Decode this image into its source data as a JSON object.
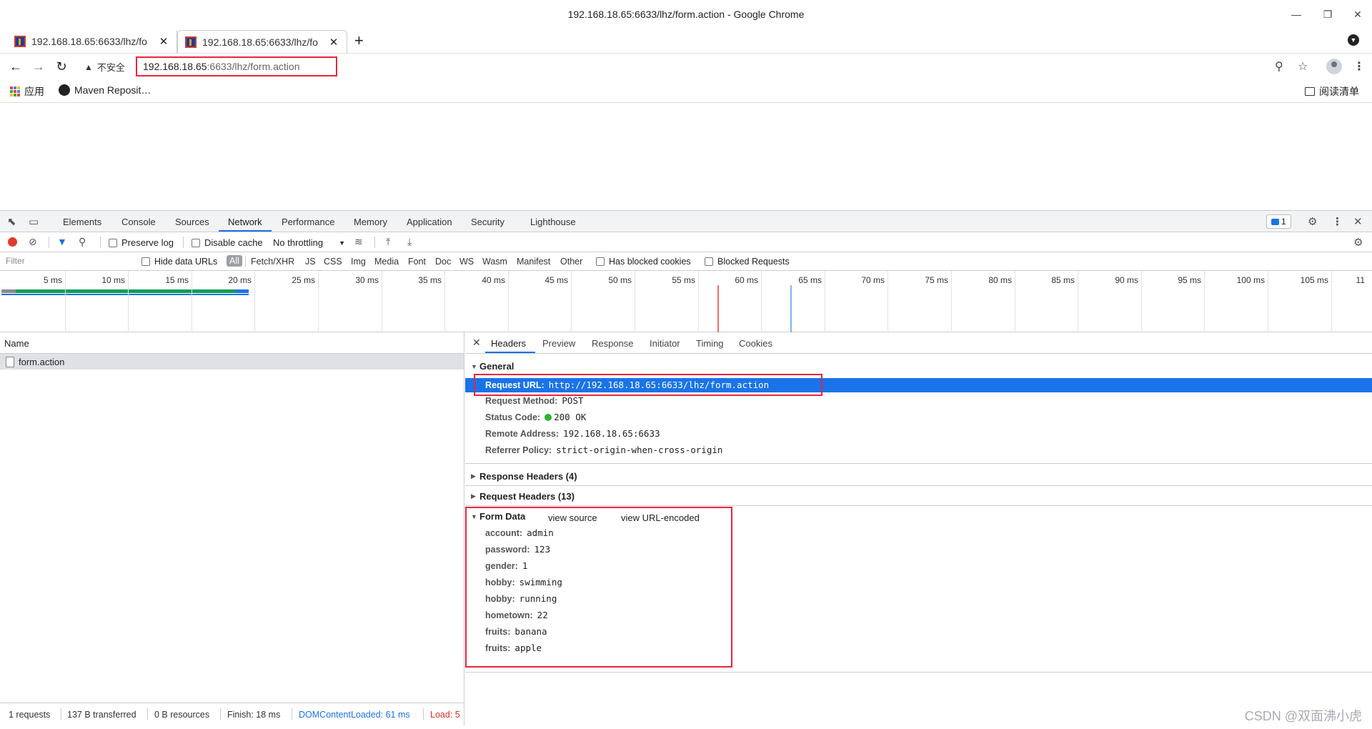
{
  "window": {
    "title": "192.168.18.65:6633/lhz/form.action - Google Chrome"
  },
  "tabs": [
    {
      "label": "192.168.18.65:6633/lhz/fo"
    },
    {
      "label": "192.168.18.65:6633/lhz/fo"
    }
  ],
  "omnibox": {
    "security_label": "不安全",
    "url_host": "192.168.18.65",
    "url_rest": ":6633/lhz/form.action"
  },
  "bookmarks": {
    "apps_label": "应用",
    "items": [
      {
        "label": "Maven Reposit…"
      }
    ],
    "reading_list": "阅读清单"
  },
  "devtools": {
    "tabs": [
      "Elements",
      "Console",
      "Sources",
      "Network",
      "Performance",
      "Memory",
      "Application",
      "Security",
      "Lighthouse"
    ],
    "active_tab": "Network",
    "issues_count": "1",
    "network_toolbar": {
      "preserve_log": "Preserve log",
      "disable_cache": "Disable cache",
      "throttling": "No throttling"
    },
    "filter": {
      "placeholder": "Filter",
      "hide_data_urls": "Hide data URLs",
      "types": [
        "All",
        "Fetch/XHR",
        "JS",
        "CSS",
        "Img",
        "Media",
        "Font",
        "Doc",
        "WS",
        "Wasm",
        "Manifest",
        "Other"
      ],
      "has_blocked_cookies": "Has blocked cookies",
      "blocked_requests": "Blocked Requests"
    },
    "timeline_ticks": [
      "5 ms",
      "10 ms",
      "15 ms",
      "20 ms",
      "25 ms",
      "30 ms",
      "35 ms",
      "40 ms",
      "45 ms",
      "50 ms",
      "55 ms",
      "60 ms",
      "65 ms",
      "70 ms",
      "75 ms",
      "80 ms",
      "85 ms",
      "90 ms",
      "95 ms",
      "100 ms",
      "105 ms",
      "11"
    ],
    "request_list": {
      "header": "Name",
      "rows": [
        {
          "name": "form.action"
        }
      ]
    },
    "detail_tabs": [
      "Headers",
      "Preview",
      "Response",
      "Initiator",
      "Timing",
      "Cookies"
    ],
    "general": {
      "title": "General",
      "rows": [
        {
          "key": "Request URL:",
          "value": "http://192.168.18.65:6633/lhz/form.action"
        },
        {
          "key": "Request Method:",
          "value": "POST"
        },
        {
          "key": "Status Code:",
          "value": "200 OK"
        },
        {
          "key": "Remote Address:",
          "value": "192.168.18.65:6633"
        },
        {
          "key": "Referrer Policy:",
          "value": "strict-origin-when-cross-origin"
        }
      ]
    },
    "response_headers": "Response Headers (4)",
    "request_headers": "Request Headers (13)",
    "form_data": {
      "title": "Form Data",
      "view_source": "view source",
      "view_url_encoded": "view URL-encoded",
      "rows": [
        {
          "key": "account:",
          "value": "admin"
        },
        {
          "key": "password:",
          "value": "123"
        },
        {
          "key": "gender:",
          "value": "1"
        },
        {
          "key": "hobby:",
          "value": "swimming"
        },
        {
          "key": "hobby:",
          "value": "running"
        },
        {
          "key": "hometown:",
          "value": "22"
        },
        {
          "key": "fruits:",
          "value": "banana"
        },
        {
          "key": "fruits:",
          "value": "apple"
        }
      ]
    },
    "status_bar": {
      "requests": "1 requests",
      "transferred": "137 B transferred",
      "resources": "0 B resources",
      "finish": "Finish: 18 ms",
      "dom_content_loaded": "DOMContentLoaded: 61 ms",
      "load": "Load: 5"
    }
  },
  "watermark": "CSDN @双面沸小虎",
  "colors": {
    "accent_blue": "#1a73e8",
    "highlight_red": "#e8253f",
    "status_green": "#2db52d",
    "record_red": "#e33a2b"
  }
}
